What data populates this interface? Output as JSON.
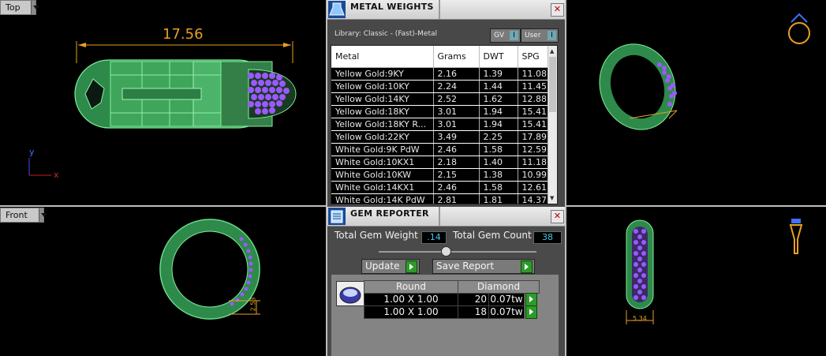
{
  "viewports": {
    "top": {
      "label": "Top",
      "dimension": "17.56",
      "axis_x": "x",
      "axis_y": "y"
    },
    "front": {
      "label": "Front",
      "dimension": "2.53"
    },
    "right_bottom": {
      "dimension": "5.34"
    }
  },
  "metal_weights": {
    "title": "METAL WEIGHTS",
    "library": "Library: Classic - (Fast)-Metal",
    "toggle_gv": "GV",
    "toggle_user": "User",
    "toggle_glyph": "I",
    "close_glyph": "✕",
    "columns": [
      "Metal",
      "Grams",
      "DWT",
      "SPG"
    ],
    "rows": [
      [
        "Yellow Gold:9KY",
        "2.16",
        "1.39",
        "11.08"
      ],
      [
        "Yellow Gold:10KY",
        "2.24",
        "1.44",
        "11.45"
      ],
      [
        "Yellow Gold:14KY",
        "2.52",
        "1.62",
        "12.88"
      ],
      [
        "Yellow Gold:18KY",
        "3.01",
        "1.94",
        "15.41"
      ],
      [
        "Yellow Gold:18KY R...",
        "3.01",
        "1.94",
        "15.41"
      ],
      [
        "Yellow Gold:22KY",
        "3.49",
        "2.25",
        "17.89"
      ],
      [
        "White Gold:9K PdW",
        "2.46",
        "1.58",
        "12.59"
      ],
      [
        "White Gold:10KX1",
        "2.18",
        "1.40",
        "11.18"
      ],
      [
        "White Gold:10KW",
        "2.15",
        "1.38",
        "10.99"
      ],
      [
        "White Gold:14KX1",
        "2.46",
        "1.58",
        "12.61"
      ],
      [
        "White Gold:14K PdW",
        "2.81",
        "1.81",
        "14.37"
      ]
    ]
  },
  "gem_reporter": {
    "title": "GEM REPORTER",
    "close_glyph": "✕",
    "total_weight_label": "Total Gem Weight",
    "total_weight_value": ".14",
    "total_count_label": "Total Gem Count",
    "total_count_value": "38",
    "update_label": "Update",
    "save_report_label": "Save Report",
    "header_shape": "Round",
    "header_material": "Diamond",
    "rows": [
      {
        "size": "1.00 X 1.00",
        "count": "20",
        "weight": "0.07tw"
      },
      {
        "size": "1.00 X 1.00",
        "count": "18",
        "weight": "0.07tw"
      }
    ]
  }
}
